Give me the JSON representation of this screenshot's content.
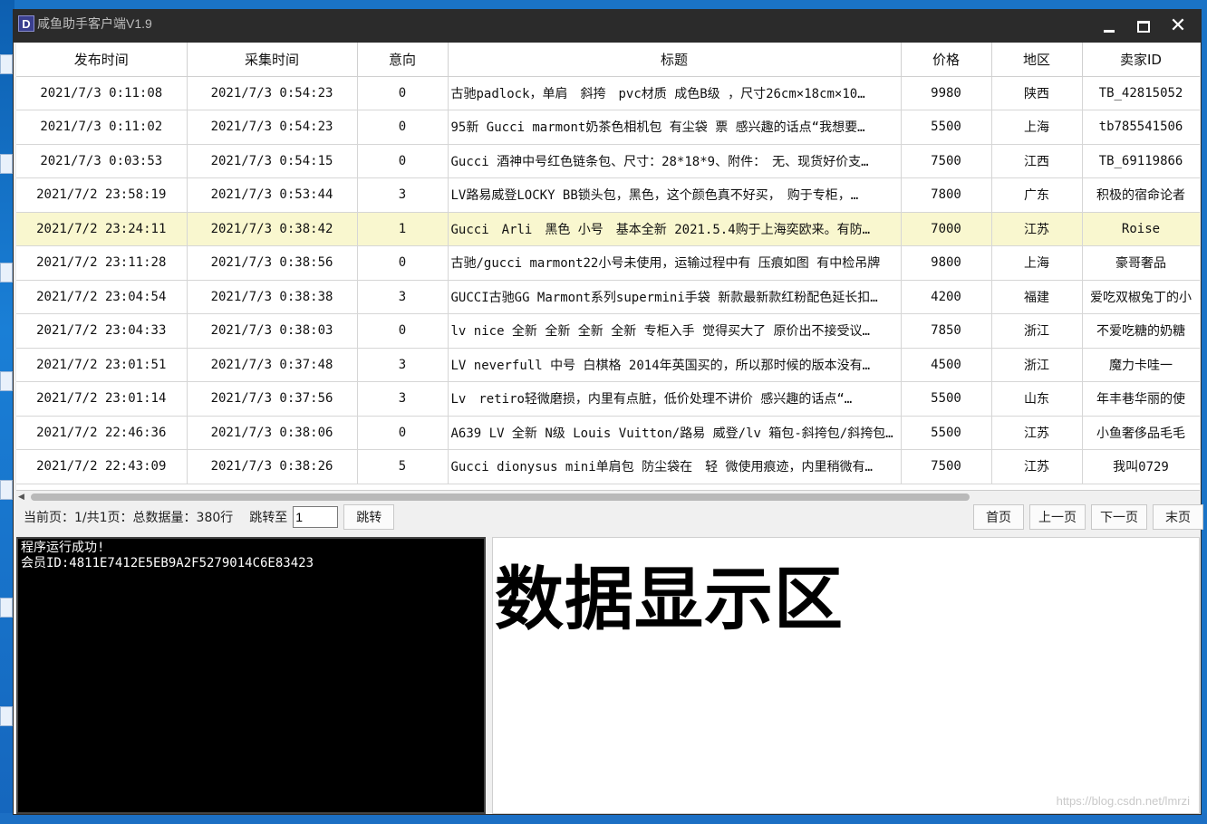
{
  "window": {
    "title": "咸鱼助手客户端V1.9",
    "icon_letter": "D"
  },
  "table": {
    "columns": [
      "发布时间",
      "采集时间",
      "意向",
      "标题",
      "价格",
      "地区",
      "卖家ID"
    ],
    "rows": [
      [
        "2021/7/3 0:11:08",
        "2021/7/3 0:54:23",
        "0",
        "古驰padlock，单肩　斜挎　pvc材质 成色B级 ，尺寸26cm×18cm×10…",
        "9980",
        "陕西",
        "TB_42815052"
      ],
      [
        "2021/7/3 0:11:02",
        "2021/7/3 0:54:23",
        "0",
        "95新 Gucci marmont奶茶色相机包 有尘袋 票 感兴趣的话点“我想要…",
        "5500",
        "上海",
        "tb785541506"
      ],
      [
        "2021/7/3 0:03:53",
        "2021/7/3 0:54:15",
        "0",
        "Gucci 酒神中号红色链条包、尺寸：28*18*9、附件：　无、现货好价支…",
        "7500",
        "江西",
        "TB_69119866"
      ],
      [
        "2021/7/2 23:58:19",
        "2021/7/3 0:53:44",
        "3",
        "LV路易威登LOCKY BB锁头包，黑色，这个颜色真不好买，　购于专柜，…",
        "7800",
        "广东",
        "积极的宿命论者"
      ],
      [
        "2021/7/2 23:24:11",
        "2021/7/3 0:38:42",
        "1",
        "Gucci　Arli　黑色 小号　基本全新 2021.5.4购于上海奕欧来。有防…",
        "7000",
        "江苏",
        "Roise"
      ],
      [
        "2021/7/2 23:11:28",
        "2021/7/3 0:38:56",
        "0",
        "古驰/gucci marmont22小号未使用，运输过程中有 压痕如图 有中检吊牌",
        "9800",
        "上海",
        "豪哥奢品"
      ],
      [
        "2021/7/2 23:04:54",
        "2021/7/3 0:38:38",
        "3",
        "GUCCI古驰GG Marmont系列supermini手袋 新款最新款红粉配色延长扣…",
        "4200",
        "福建",
        "爱吃双椒兔丁的小"
      ],
      [
        "2021/7/2 23:04:33",
        "2021/7/3 0:38:03",
        "0",
        "lv nice 全新 全新 全新 全新 专柜入手 觉得买大了 原价出不接受议…",
        "7850",
        "浙江",
        "不爱吃糖的奶糖"
      ],
      [
        "2021/7/2 23:01:51",
        "2021/7/3 0:37:48",
        "3",
        "LV neverfull 中号 白棋格 2014年英国买的，所以那时候的版本没有…",
        "4500",
        "浙江",
        "魔力卡哇一"
      ],
      [
        "2021/7/2 23:01:14",
        "2021/7/3 0:37:56",
        "3",
        "Lv　retiro轻微磨损，内里有点脏，低价处理不讲价 感兴趣的话点“…",
        "5500",
        "山东",
        "年丰巷华丽的使"
      ],
      [
        "2021/7/2 22:46:36",
        "2021/7/3 0:38:06",
        "0",
        "A639 LV 全新 N级 Louis Vuitton/路易 威登/lv 箱包-斜挎包/斜挎包…",
        "5500",
        "江苏",
        "小鱼奢侈品毛毛"
      ],
      [
        "2021/7/2 22:43:09",
        "2021/7/3 0:38:26",
        "5",
        "Gucci dionysus mini单肩包 防尘袋在　轻 微使用痕迹，内里稍微有…",
        "7500",
        "江苏",
        "我叫0729"
      ]
    ],
    "selected_row": 4
  },
  "pager": {
    "info": "当前页：1/共1页：总数据量：380行",
    "jump_label": "跳转至",
    "jump_value": "1",
    "jump_button": "跳转",
    "first": "首页",
    "prev": "上一页",
    "next": "下一页",
    "last": "末页"
  },
  "console": {
    "lines": [
      "程序运行成功!",
      "会员ID:4811E7412E5EB9A2F5279014C6E83423"
    ]
  },
  "display": {
    "title": "数据显示区"
  },
  "watermark": "https://blog.csdn.net/lmrzi"
}
